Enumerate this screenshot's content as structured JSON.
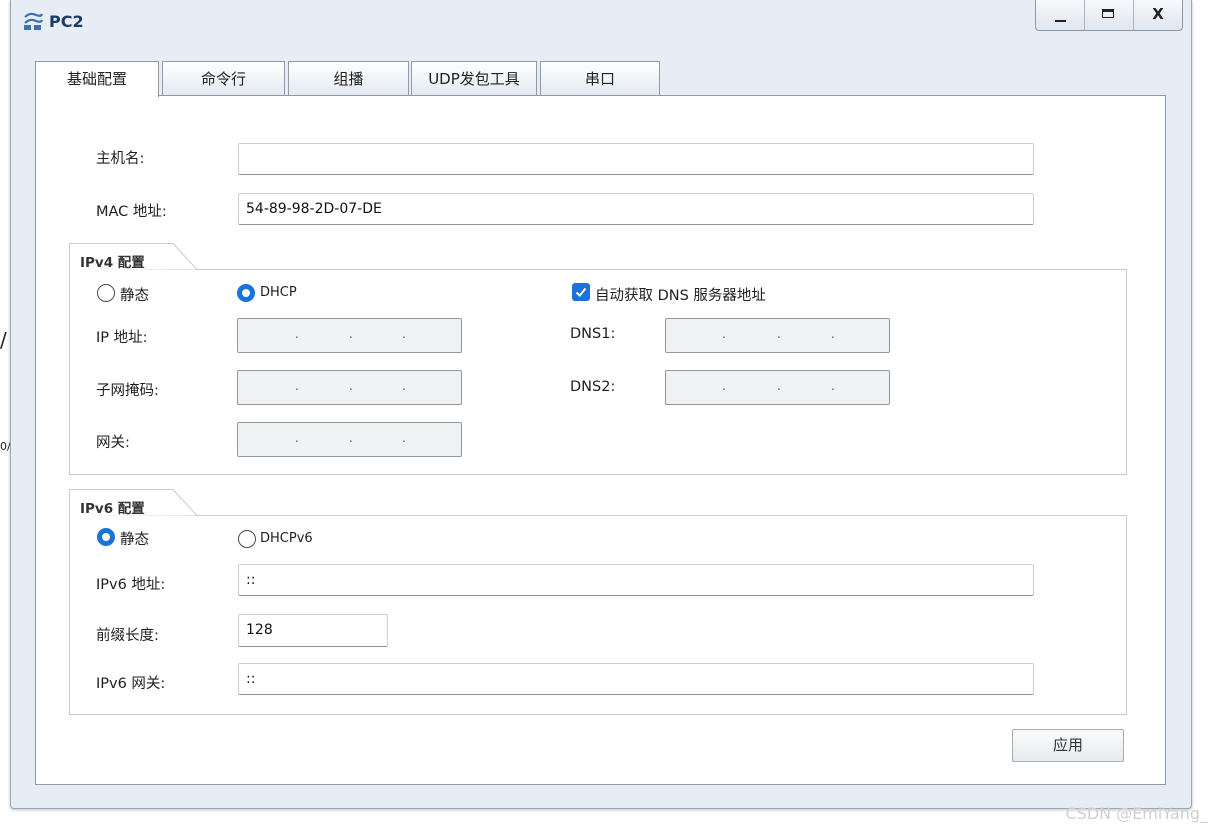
{
  "window": {
    "title": "PC2",
    "close_label": "X"
  },
  "tabs": [
    {
      "label": "基础配置",
      "active": true
    },
    {
      "label": "命令行"
    },
    {
      "label": "组播"
    },
    {
      "label": "UDP发包工具"
    },
    {
      "label": "串口"
    }
  ],
  "host": {
    "hostname_label": "主机名:",
    "hostname_value": "",
    "mac_label": "MAC 地址:",
    "mac_value": "54-89-98-2D-07-DE"
  },
  "ipv4": {
    "group_title": "IPv4 配置",
    "static_label": "静态",
    "static_selected": false,
    "dhcp_label": "DHCP",
    "dhcp_selected": true,
    "auto_dns_label": "自动获取 DNS 服务器地址",
    "auto_dns_checked": true,
    "ip_label": "IP 地址:",
    "mask_label": "子网掩码:",
    "gateway_label": "网关:",
    "dns1_label": "DNS1:",
    "dns2_label": "DNS2:",
    "ip_separator": "."
  },
  "ipv6": {
    "group_title": "IPv6 配置",
    "static_label": "静态",
    "static_selected": true,
    "dhcp_label": "DHCPv6",
    "dhcp_selected": false,
    "address_label": "IPv6 地址:",
    "address_value": "::",
    "prefix_label": "前缀长度:",
    "prefix_value": "128",
    "gateway_label": "IPv6 网关:",
    "gateway_value": "::"
  },
  "apply_label": "应用",
  "background_fragments": {
    "frag1": "/",
    "frag2": "0/"
  },
  "watermark": "CSDN @EmiYang_",
  "colors": {
    "accent": "#1a73d8",
    "frame_bg": "#e6edf4",
    "title": "#1b3a66"
  }
}
